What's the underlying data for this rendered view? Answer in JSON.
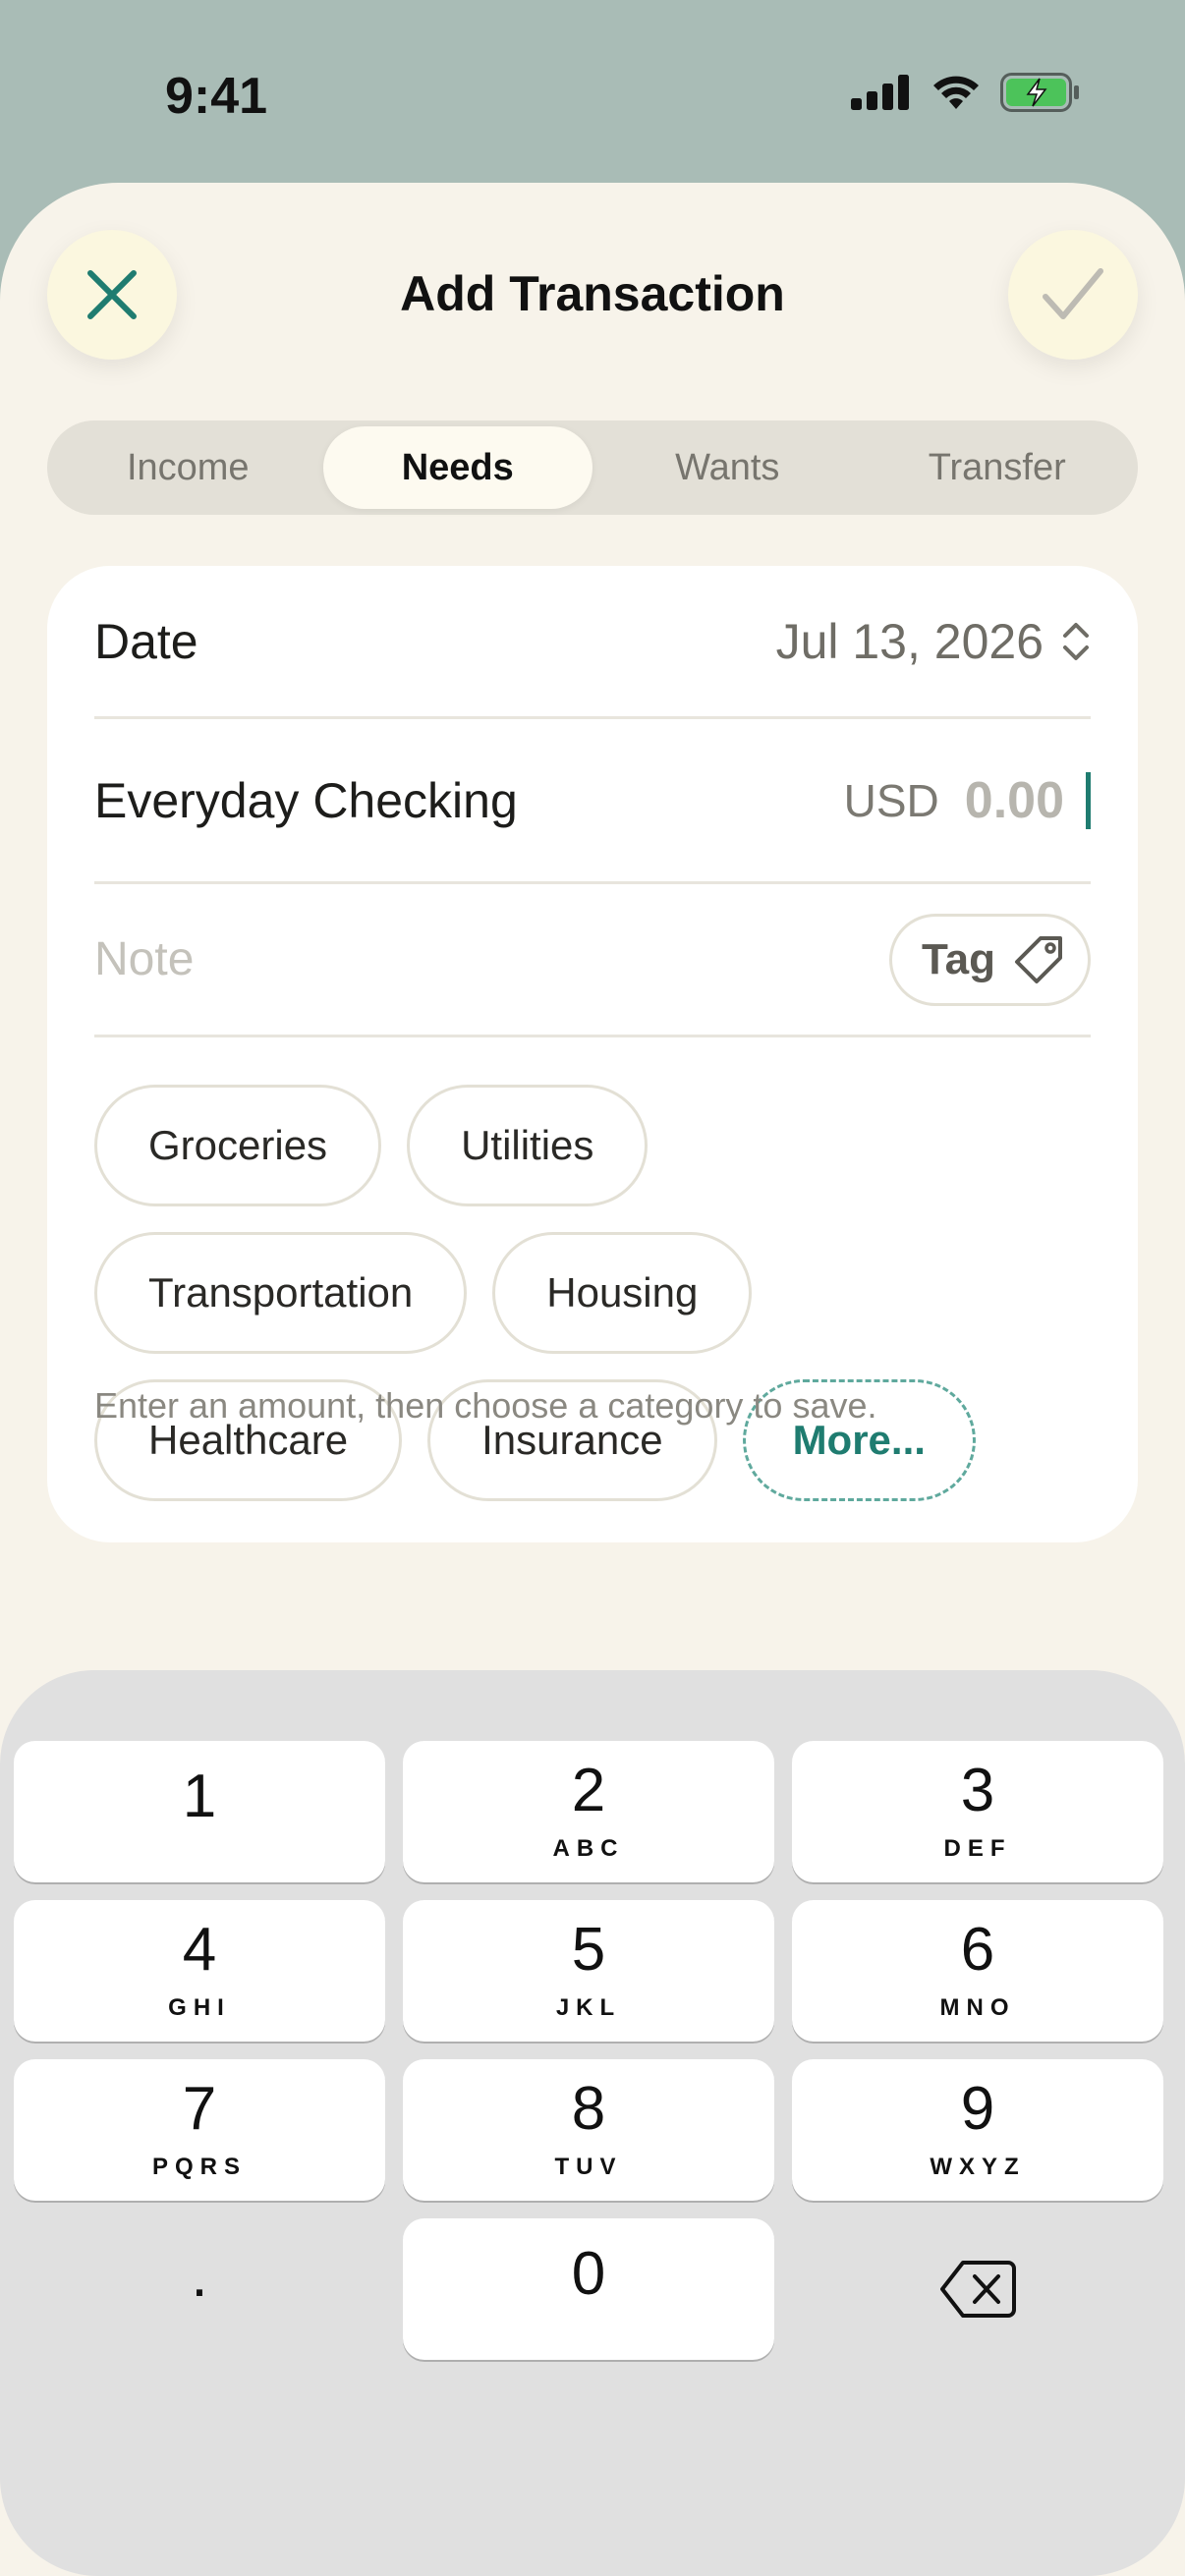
{
  "status_bar": {
    "time": "9:41"
  },
  "sheet": {
    "title": "Add Transaction",
    "close_icon": "close-icon",
    "confirm_icon": "checkmark-icon"
  },
  "segments": [
    {
      "label": "Income",
      "active": false
    },
    {
      "label": "Needs",
      "active": true
    },
    {
      "label": "Wants",
      "active": false
    },
    {
      "label": "Transfer",
      "active": false
    }
  ],
  "form": {
    "date_label": "Date",
    "date_value": "Jul 13, 2026",
    "account_label": "Everyday Checking",
    "currency": "USD",
    "amount": "0.00",
    "note_placeholder": "Note",
    "tag_label": "Tag"
  },
  "categories": {
    "row1": [
      "Groceries",
      "Utilities"
    ],
    "row2": [
      "Transportation",
      "Housing"
    ],
    "row3": [
      "Healthcare",
      "Insurance"
    ],
    "more_label": "More..."
  },
  "hint": "Enter an amount, then choose a category to save.",
  "keypad": [
    {
      "num": "1",
      "letters": ""
    },
    {
      "num": "2",
      "letters": "ABC"
    },
    {
      "num": "3",
      "letters": "DEF"
    },
    {
      "num": "4",
      "letters": "GHI"
    },
    {
      "num": "5",
      "letters": "JKL"
    },
    {
      "num": "6",
      "letters": "MNO"
    },
    {
      "num": "7",
      "letters": "PQRS"
    },
    {
      "num": "8",
      "letters": "TUV"
    },
    {
      "num": "9",
      "letters": "WXYZ"
    },
    {
      "num": ".",
      "letters": ""
    },
    {
      "num": "0",
      "letters": ""
    },
    {
      "num": "",
      "letters": "",
      "icon": "backspace-icon"
    }
  ],
  "colors": {
    "accent": "#1f7c70",
    "sheet_bg": "#f7f3ea",
    "backdrop": "#a9bcb6"
  }
}
